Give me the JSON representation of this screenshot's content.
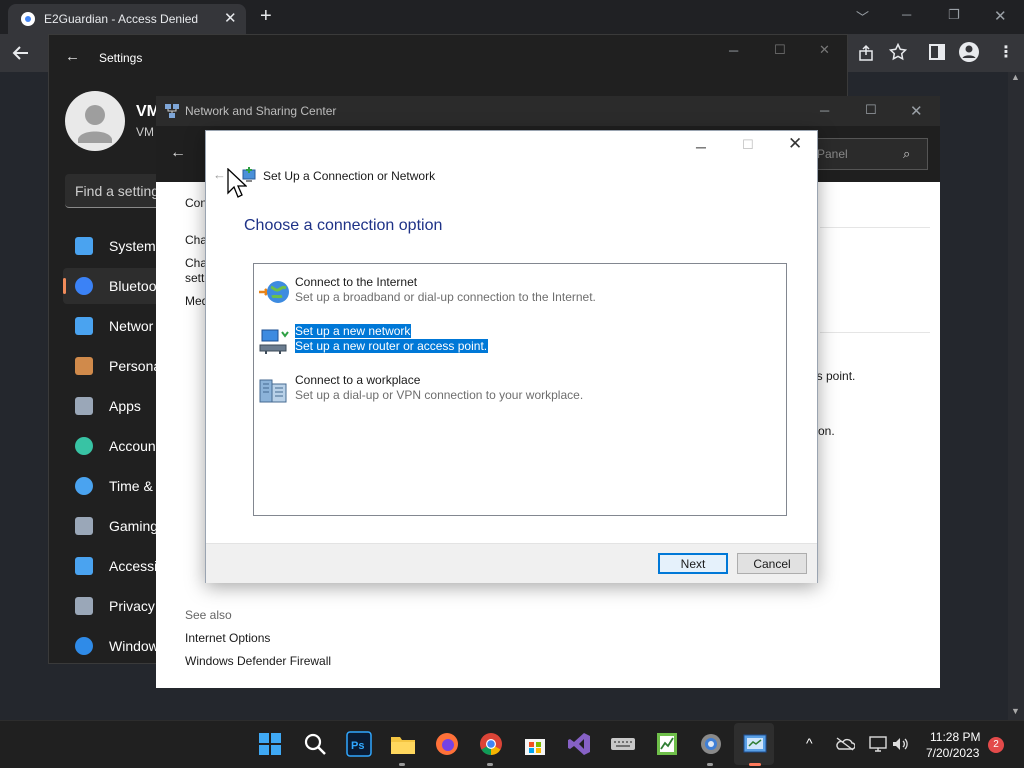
{
  "chrome": {
    "tab_title": "E2Guardian - Access Denied",
    "tab_close": "✕",
    "new_tab": "+",
    "window_controls": {
      "min": "─",
      "max": "❐",
      "close": "✕"
    }
  },
  "settings": {
    "title": "Settings",
    "user_name": "VM",
    "user_sub": "VM",
    "search_placeholder": "Find a setting",
    "nav": [
      {
        "label": "System",
        "icon": "monitor-icon"
      },
      {
        "label": "Bluetoo",
        "icon": "bluetooth-icon",
        "active": true
      },
      {
        "label": "Networ",
        "icon": "wifi-icon"
      },
      {
        "label": "Persona",
        "icon": "brush-icon"
      },
      {
        "label": "Apps",
        "icon": "apps-icon"
      },
      {
        "label": "Accoun",
        "icon": "account-icon"
      },
      {
        "label": "Time &",
        "icon": "clock-icon"
      },
      {
        "label": "Gaming",
        "icon": "gamepad-icon"
      },
      {
        "label": "Accessi",
        "icon": "accessibility-icon"
      },
      {
        "label": "Privacy",
        "icon": "shield-icon"
      },
      {
        "label": "Window",
        "icon": "update-icon"
      }
    ]
  },
  "nsc": {
    "title": "Network and Sharing Center",
    "search_text": "Panel",
    "left_links": [
      "Con",
      "Cha",
      "Cha",
      "setti",
      "Med"
    ],
    "right_texts": [
      "ess point.",
      "on."
    ],
    "see_also": "See also",
    "see_also_links": [
      "Internet Options",
      "Windows Defender Firewall"
    ]
  },
  "dialog": {
    "title": "Set Up a Connection or Network",
    "heading": "Choose a connection option",
    "options": [
      {
        "title": "Connect to the Internet",
        "desc": "Set up a broadband or dial-up connection to the Internet.",
        "icon": "globe-icon",
        "selected": false
      },
      {
        "title": "Set up a new network",
        "desc": "Set up a new router or access point.",
        "icon": "router-icon",
        "selected": true
      },
      {
        "title": "Connect to a workplace",
        "desc": "Set up a dial-up or VPN connection to your workplace.",
        "icon": "workplace-icon",
        "selected": false
      }
    ],
    "next_label": "Next",
    "cancel_label": "Cancel"
  },
  "taskbar": {
    "time": "11:28 PM",
    "date": "7/20/2023",
    "badge": "2"
  },
  "colors": {
    "selection": "#0078d7",
    "heading": "#1e3287",
    "settings_accent": "#f08b5a"
  }
}
